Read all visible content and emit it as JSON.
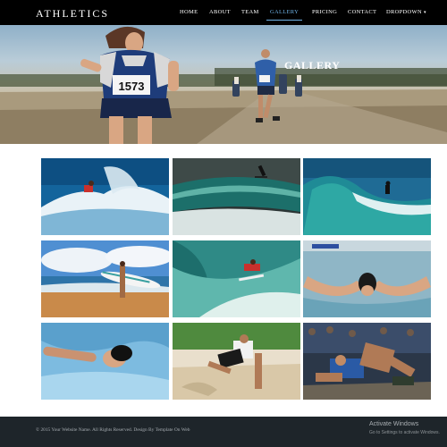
{
  "brand": "ATHLETICS",
  "nav": {
    "items": [
      {
        "label": "HOME"
      },
      {
        "label": "ABOUT"
      },
      {
        "label": "TEAM"
      },
      {
        "label": "GALLERY"
      },
      {
        "label": "PRICING"
      },
      {
        "label": "CONTACT"
      },
      {
        "label": "DROPDOWN"
      }
    ],
    "active": "GALLERY",
    "dropdown_caret": "▾"
  },
  "hero": {
    "title": "GALLERY",
    "bib_number": "1573",
    "image": "marathon-runners-photo"
  },
  "gallery": {
    "images": [
      {
        "subject": "surfer-wave-photo"
      },
      {
        "subject": "surfer-aerial-photo"
      },
      {
        "subject": "surfer-barrel-photo"
      },
      {
        "subject": "beach-surfboard-photo"
      },
      {
        "subject": "surfer-turn-photo"
      },
      {
        "subject": "butterfly-swimmer-photo"
      },
      {
        "subject": "freestyle-swimmer-photo"
      },
      {
        "subject": "sand-wrestling-photo"
      },
      {
        "subject": "wrestling-match-photo"
      }
    ]
  },
  "footer": {
    "copyright": "© 2015 Your Website Name. All Rights Reserved. Design By Template On Web"
  },
  "watermark": {
    "title": "Activate Windows",
    "subtitle": "Go to Settings to activate Windows."
  },
  "colors": {
    "navbar_bg": "#000000",
    "nav_active": "#6fb3e6",
    "footer_bg": "#1e252a"
  }
}
